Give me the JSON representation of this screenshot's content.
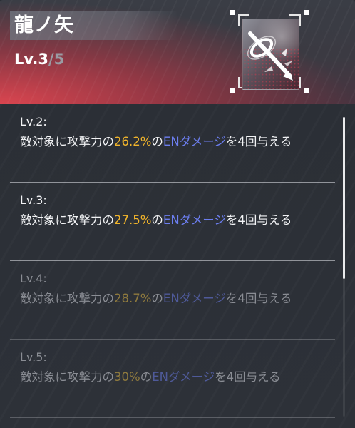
{
  "skill": {
    "name": "龍ノ矢",
    "level_prefix": "Lv.",
    "level_current": "3",
    "level_sep": "/",
    "level_max": "5"
  },
  "icon": {
    "name": "dragon-arrow-skill-icon"
  },
  "entries": [
    {
      "level": "Lv.2:",
      "t1": "敵対象に攻撃力の",
      "pct": "26.2%",
      "t2": "の",
      "en": "ENダメージ",
      "t3": "を4回与える",
      "dimmed": false
    },
    {
      "level": "Lv.3:",
      "t1": "敵対象に攻撃力の",
      "pct": "27.5%",
      "t2": "の",
      "en": "ENダメージ",
      "t3": "を4回与える",
      "dimmed": false
    },
    {
      "level": "Lv.4:",
      "t1": "敵対象に攻撃力の",
      "pct": "28.7%",
      "t2": "の",
      "en": "ENダメージ",
      "t3": "を4回与える",
      "dimmed": true
    },
    {
      "level": "Lv.5:",
      "t1": "敵対象に攻撃力の",
      "pct": "30%",
      "t2": "の",
      "en": "ENダメージ",
      "t3": "を4回与える",
      "dimmed": true
    }
  ],
  "colors": {
    "percent": "#f2b52b",
    "en_damage": "#6c7ef0",
    "header_accent": "#e14650"
  },
  "scroll": {
    "position_fraction": 0.0,
    "visible_fraction": 0.54
  }
}
